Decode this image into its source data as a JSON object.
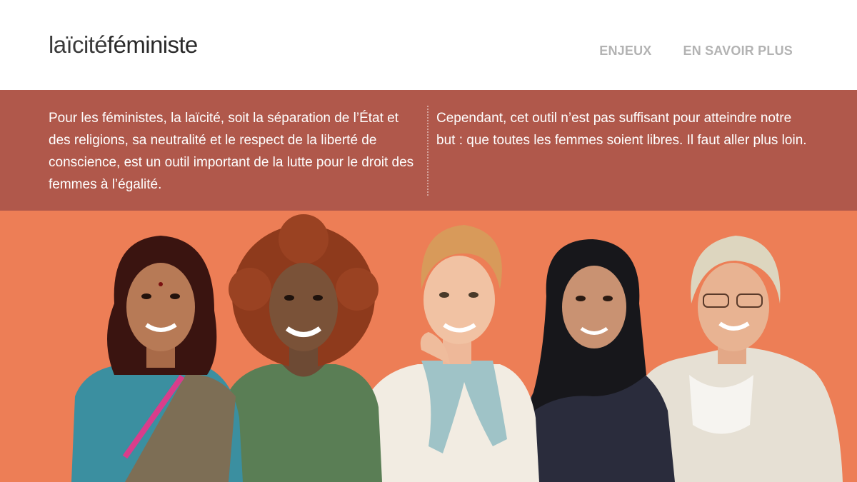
{
  "header": {
    "logo_part1": "laïcité",
    "logo_part2": "féministe",
    "nav": [
      {
        "label": "ENJEUX"
      },
      {
        "label": "EN SAVOIR PLUS"
      }
    ]
  },
  "intro": {
    "left_text": "Pour les féministes, la laïcité, soit la séparation de l’État et des religions, sa neutralité et le respect de la liberté de conscience, est un outil important de la lutte pour le droit des femmes à l’égalité.",
    "right_text": "Cependant, cet outil n’est pas suffisant pour atteindre notre but : que toutes les femmes soient libres. Il faut aller plus loin."
  },
  "colors": {
    "band": "#b0584b",
    "hero_background": "#ed7e56",
    "nav_text": "#b3b3b3"
  }
}
